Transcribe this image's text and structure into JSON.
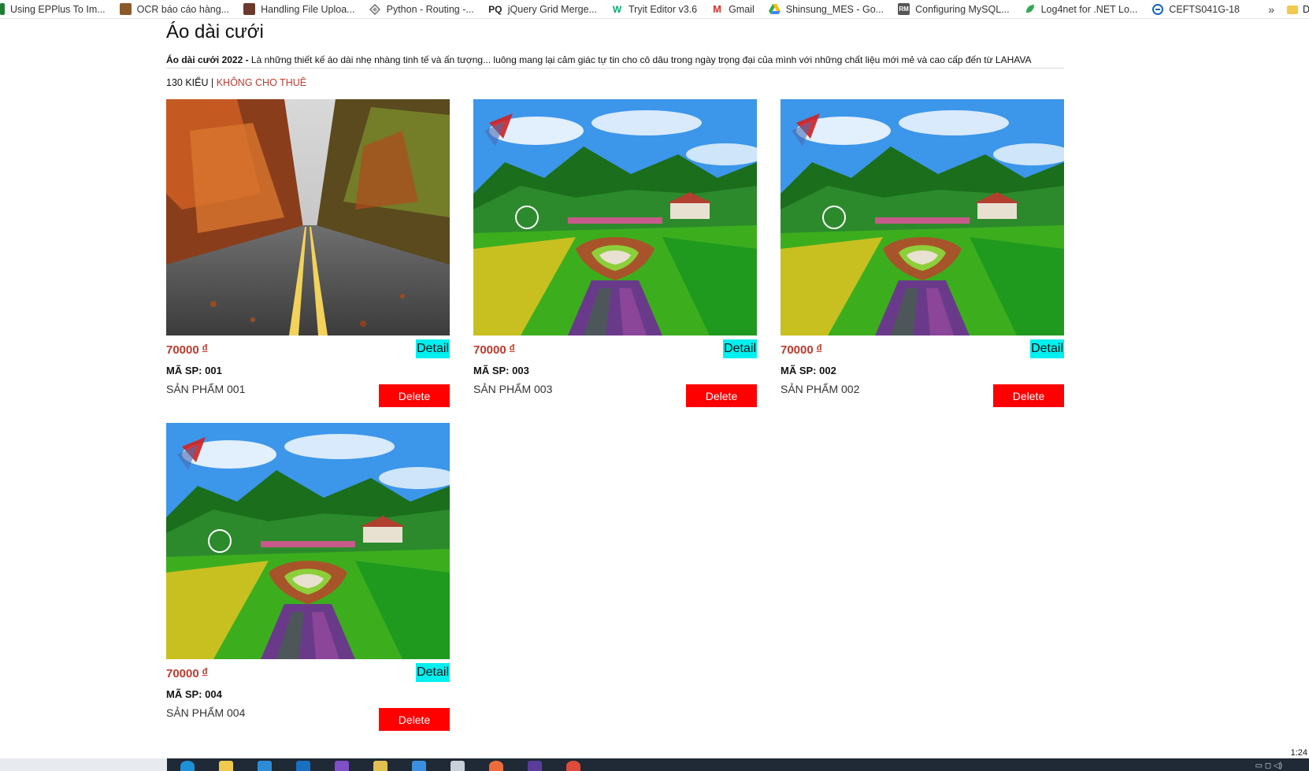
{
  "bookmarks": [
    {
      "label": "Using EPPlus To Im...",
      "icon": "epplus-icon",
      "color": "#1e7e34"
    },
    {
      "label": "OCR báo cáo hàng...",
      "icon": "ocr-icon",
      "color": "#8b5a2b"
    },
    {
      "label": "Handling File Uploa...",
      "icon": "file-upload-icon",
      "color": "#6b3a2a"
    },
    {
      "label": "Python - Routing -...",
      "icon": "python-diamond-icon",
      "color": "#777777"
    },
    {
      "label": "jQuery Grid Merge...",
      "icon": "pq-icon",
      "color": "#222222"
    },
    {
      "label": "Tryit Editor v3.6",
      "icon": "w3schools-icon",
      "color": "#04aa6d"
    },
    {
      "label": "Gmail",
      "icon": "gmail-icon",
      "color": "#d93025"
    },
    {
      "label": "Shinsung_MES - Go...",
      "icon": "google-drive-icon",
      "color": "#1a73e8"
    },
    {
      "label": "Configuring MySQL...",
      "icon": "rm-icon",
      "color": "#555555"
    },
    {
      "label": "Log4net for .NET Lo...",
      "icon": "log4net-icon",
      "color": "#34a853"
    },
    {
      "label": "CEFTS041G-18",
      "icon": "cefts-icon",
      "color": "#1565c0"
    }
  ],
  "bookmarks_more": "»",
  "bookmarks_folder": "Da",
  "page": {
    "title": "Áo dài cưới",
    "desc_bold": "Áo dài cưới 2022 -",
    "desc_text": " Là những thiết kế áo dài nhẹ nhàng tinh tế và ấn tượng... luông mang lại cảm giác tự tin cho cô dâu trong ngày trọng đại của mình với những chất liệu mới mẻ và cao cấp đến từ LAHAVA",
    "count": "130 KIỂU",
    "separator": " | ",
    "rent": "KHÔNG CHO THUÊ"
  },
  "products": [
    {
      "price": "70000",
      "currency": "đ",
      "detail_label": "Detail",
      "code": "MÃ SP: 001",
      "name": "SẢN PHẨM 001",
      "delete_label": "Delete",
      "image": "autumn-road"
    },
    {
      "price": "70000",
      "currency": "đ",
      "detail_label": "Detail",
      "code": "MÃ SP: 003",
      "name": "SẢN PHẨM 003",
      "delete_label": "Delete",
      "image": "flower-garden"
    },
    {
      "price": "70000",
      "currency": "đ",
      "detail_label": "Detail",
      "code": "MÃ SP: 002",
      "name": "SẢN PHẨM 002",
      "delete_label": "Delete",
      "image": "flower-garden"
    },
    {
      "price": "70000",
      "currency": "đ",
      "detail_label": "Detail",
      "code": "MÃ SP: 004",
      "name": "SẢN PHẨM 004",
      "delete_label": "Delete",
      "image": "flower-garden"
    }
  ],
  "colors": {
    "price": "#c0392b",
    "detail_bg": "#00f0f0",
    "delete_bg": "#ff0000",
    "taskbar": "#1f2a36"
  },
  "taskbar": {
    "time": "1:24"
  }
}
